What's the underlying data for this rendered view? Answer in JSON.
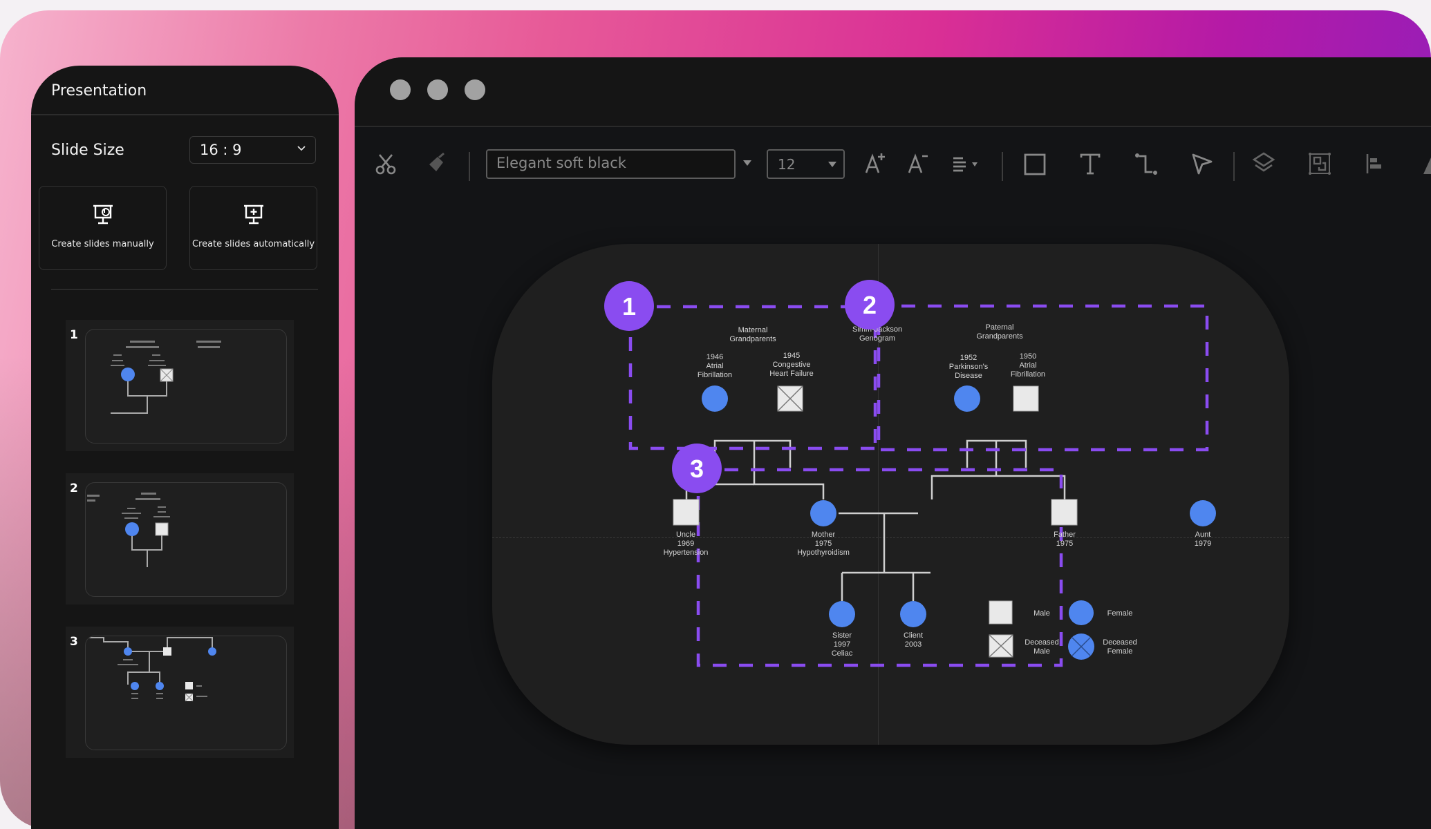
{
  "panel": {
    "title": "Presentation",
    "slide_size_label": "Slide Size",
    "slide_size_value": "16 : 9",
    "create_manual_label": "Create slides manually",
    "create_auto_label": "Create slides automatically",
    "thumbnails": [
      {
        "number": "1"
      },
      {
        "number": "2"
      },
      {
        "number": "3"
      }
    ]
  },
  "toolbar": {
    "font_name": "Elegant soft black",
    "font_size": "12"
  },
  "genogram": {
    "title": [
      "Simm-Jackson",
      "Genogram"
    ],
    "section_badges": [
      "1",
      "2",
      "3"
    ],
    "maternal_label": [
      "Maternal",
      "Grandparents"
    ],
    "paternal_label": [
      "Paternal",
      "Grandparents"
    ],
    "people": {
      "maternal_grandmother": [
        "1946",
        "Atrial",
        "Fibrillation"
      ],
      "maternal_grandfather": [
        "1945",
        "Congestive",
        "Heart Failure"
      ],
      "paternal_grandmother": [
        "1952",
        "Parkinson's",
        "Disease"
      ],
      "paternal_grandfather": [
        "1950",
        "Atrial",
        "Fibrillation"
      ],
      "uncle": [
        "Uncle",
        "1969",
        "Hypertension"
      ],
      "mother": [
        "Mother",
        "1975",
        "Hypothyroidism"
      ],
      "father": [
        "Father",
        "1975"
      ],
      "aunt": [
        "Aunt",
        "1979"
      ],
      "sister": [
        "Sister",
        "1997",
        "Celiac"
      ],
      "client": [
        "Client",
        "2003"
      ]
    },
    "legend": {
      "male": "Male",
      "female": "Female",
      "deceased_male": [
        "Deceased",
        "Male"
      ],
      "deceased_female": [
        "Deceased",
        "Female"
      ]
    },
    "colors": {
      "female": "#4f86ef",
      "male": "#e9e9e9",
      "accent": "#8a4cf0"
    }
  }
}
